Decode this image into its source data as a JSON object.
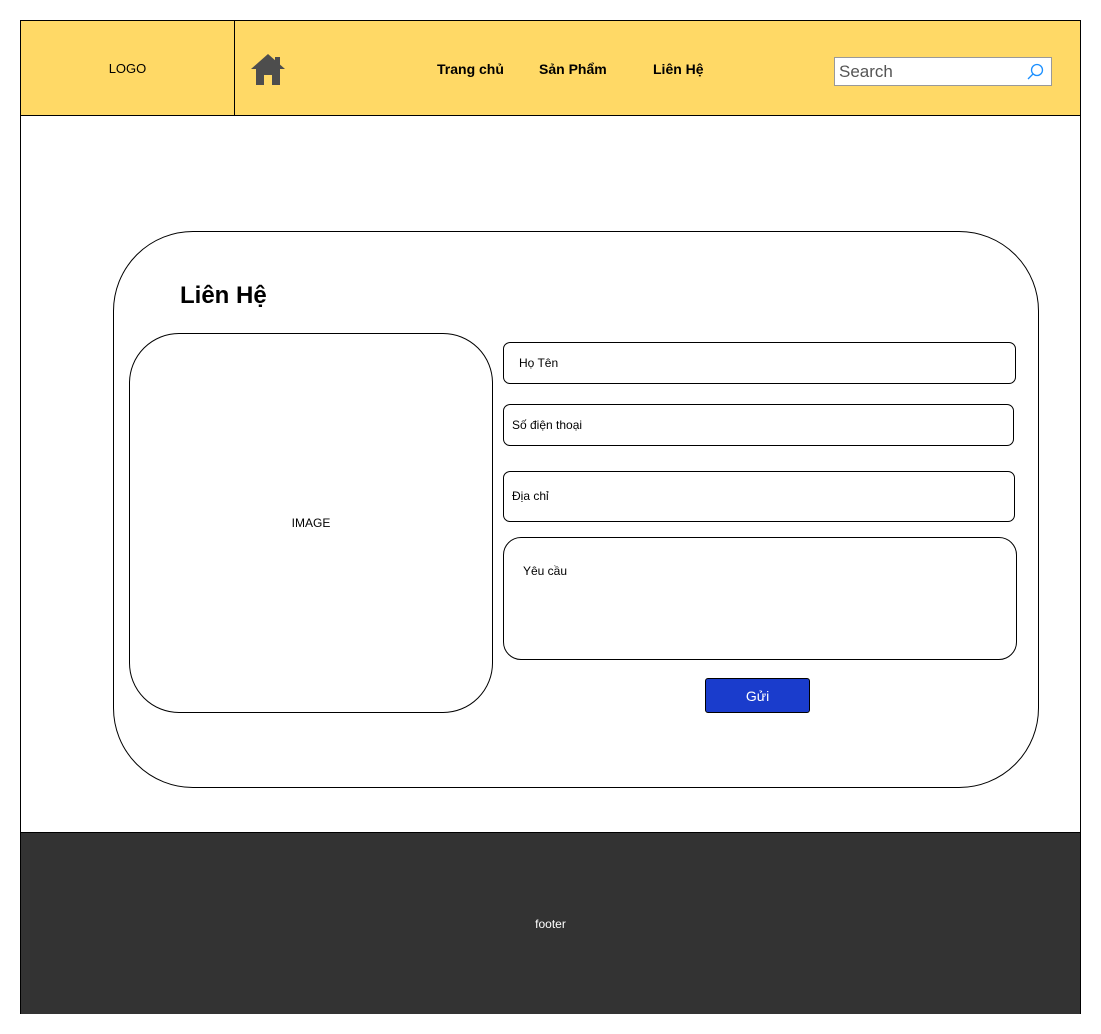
{
  "header": {
    "logo_label": "LOGO",
    "nav": [
      {
        "label": "Trang chủ"
      },
      {
        "label": "Sản Phẩm"
      },
      {
        "label": "Liên Hệ"
      }
    ],
    "search": {
      "placeholder": "Search",
      "value": ""
    }
  },
  "contact": {
    "title": "Liên Hệ",
    "image_label": "IMAGE",
    "fields": {
      "name": "Họ Tên",
      "phone": "Số điện thoại",
      "address": "Địa chỉ",
      "request": "Yêu cầu"
    },
    "submit_label": "Gửi"
  },
  "footer": {
    "label": "footer"
  },
  "colors": {
    "header_bg": "#ffd966",
    "icon_gray": "#4d4d4d",
    "search_icon": "#1a8fff",
    "submit_bg": "#1a3ccc",
    "footer_bg": "#333333"
  },
  "icons": {
    "home": "home-icon",
    "search": "search-icon"
  }
}
